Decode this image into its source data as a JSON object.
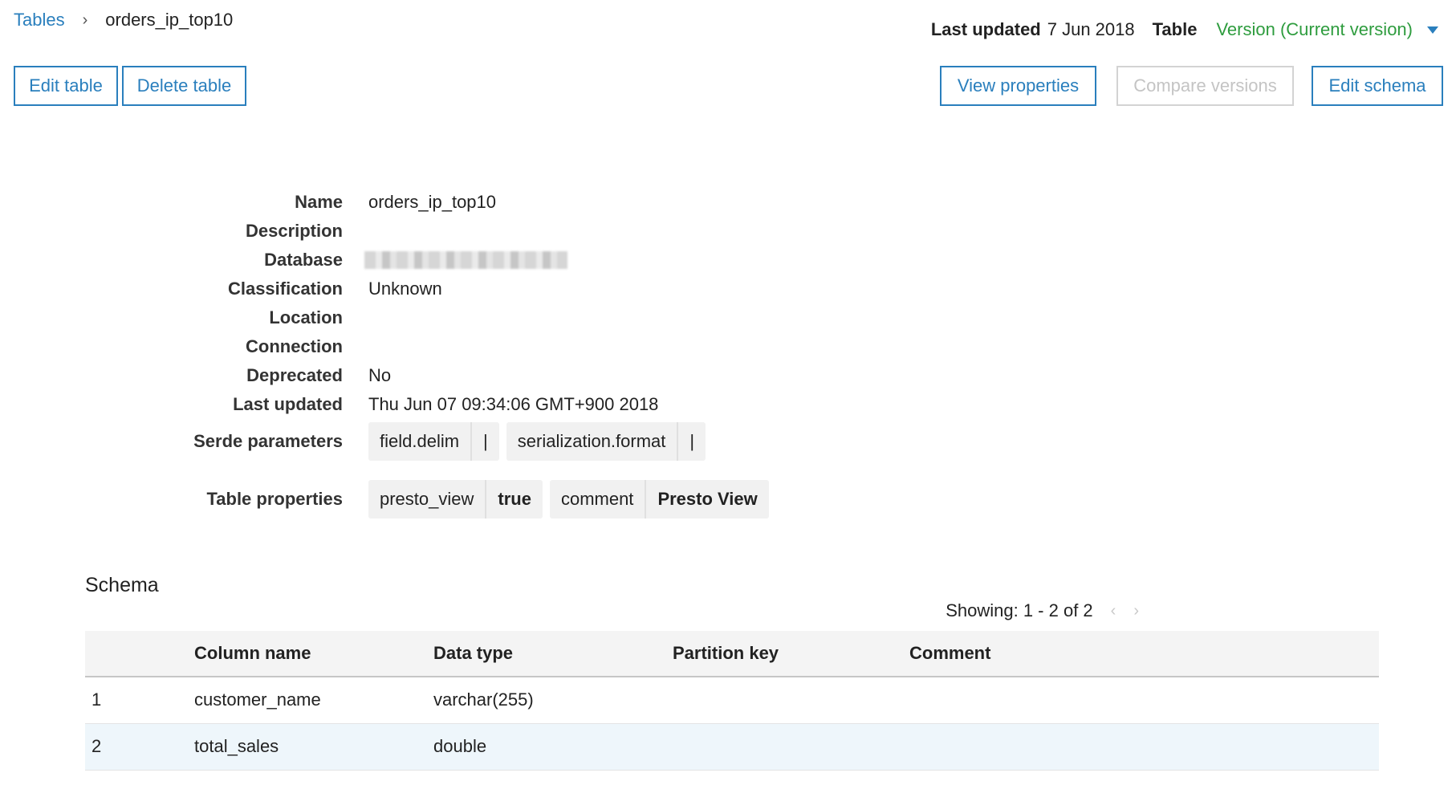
{
  "breadcrumb": {
    "root": "Tables",
    "current": "orders_ip_top10"
  },
  "meta": {
    "last_updated_label": "Last updated",
    "last_updated_value": "7 Jun 2018",
    "type": "Table",
    "version": "Version (Current version)"
  },
  "buttons": {
    "edit_table": "Edit table",
    "delete_table": "Delete table",
    "view_properties": "View properties",
    "compare_versions": "Compare versions",
    "edit_schema": "Edit schema"
  },
  "details": [
    {
      "label": "Name",
      "value": "orders_ip_top10"
    },
    {
      "label": "Description",
      "value": ""
    },
    {
      "label": "Database",
      "value": ""
    },
    {
      "label": "Classification",
      "value": "Unknown"
    },
    {
      "label": "Location",
      "value": ""
    },
    {
      "label": "Connection",
      "value": ""
    },
    {
      "label": "Deprecated",
      "value": "No"
    },
    {
      "label": "Last updated",
      "value": "Thu Jun 07 09:34:06 GMT+900 2018"
    }
  ],
  "serde": {
    "label": "Serde parameters",
    "items": [
      {
        "key": "field.delim",
        "value": "|"
      },
      {
        "key": "serialization.format",
        "value": "|"
      }
    ]
  },
  "table_properties": {
    "label": "Table properties",
    "items": [
      {
        "key": "presto_view",
        "value": "true"
      },
      {
        "key": "comment",
        "value": "Presto View"
      }
    ]
  },
  "schema": {
    "title": "Schema",
    "pager": "Showing: 1 - 2 of 2",
    "columns": [
      "",
      "Column name",
      "Data type",
      "Partition key",
      "Comment"
    ],
    "rows": [
      [
        "1",
        "customer_name",
        "varchar(255)",
        "",
        ""
      ],
      [
        "2",
        "total_sales",
        "double",
        "",
        ""
      ]
    ]
  },
  "colors": {
    "link": "#2a7fbd",
    "version": "#2e9c3e",
    "selected_row": "#eef6fb"
  }
}
